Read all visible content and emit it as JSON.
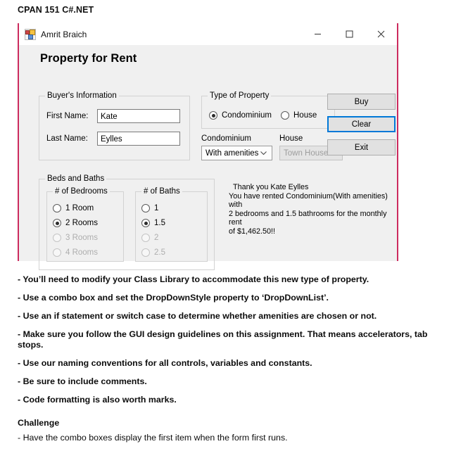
{
  "document": {
    "heading": "CPAN 151 C#.NET"
  },
  "window": {
    "title": "Amrit Braich",
    "icon": "winforms-app-icon",
    "controls": {
      "minimize": "minimize-icon",
      "maximize": "maximize-icon",
      "close": "close-icon"
    },
    "form_title": "Property for Rent"
  },
  "buyer_group": {
    "legend": "Buyer's Information",
    "first_name_label": "First Name:",
    "first_name_value": "Kate",
    "last_name_label": "Last Name:",
    "last_name_value": "Eylles"
  },
  "type_group": {
    "legend": "Type of Property",
    "options": [
      {
        "label": "Condominium",
        "checked": true,
        "enabled": true
      },
      {
        "label": "House",
        "checked": false,
        "enabled": true
      }
    ]
  },
  "combos": {
    "condominium_label": "Condominium",
    "condominium_value": "With amenities",
    "condominium_enabled": true,
    "house_label": "House",
    "house_value": "Town House",
    "house_enabled": false
  },
  "buttons": {
    "buy": "Buy",
    "clear": "Clear",
    "exit": "Exit",
    "focused": "Clear",
    "focus_color": "#0078d7"
  },
  "beds_baths": {
    "legend": "Beds and Baths",
    "bedrooms_legend": "# of Bedrooms",
    "bedrooms": [
      {
        "label": "1 Room",
        "checked": false,
        "enabled": true
      },
      {
        "label": "2 Rooms",
        "checked": true,
        "enabled": true
      },
      {
        "label": "3 Rooms",
        "checked": false,
        "enabled": false
      },
      {
        "label": "4 Rooms",
        "checked": false,
        "enabled": false
      }
    ],
    "baths_legend": "# of Baths",
    "baths": [
      {
        "label": "1",
        "checked": false,
        "enabled": true
      },
      {
        "label": "1.5",
        "checked": true,
        "enabled": true
      },
      {
        "label": "2",
        "checked": false,
        "enabled": false
      },
      {
        "label": "2.5",
        "checked": false,
        "enabled": false
      }
    ]
  },
  "result": {
    "line1": "Thank you Kate Eylles",
    "line2": "You have rented Condominium(With amenities) with",
    "line3": "2 bedrooms and 1.5 bathrooms for the monthly rent",
    "line4": "of $1,462.50!!"
  },
  "instructions": {
    "items": [
      "- You’ll need to modify your Class Library to accommodate this new type of property.",
      "- Use a combo box and set the DropDownStyle property to ‘DropDownList’.",
      "- Use an if statement or switch case to determine whether amenities are chosen or not.",
      "- Make sure you follow the GUI design guidelines on this assignment. That means accelerators, tab stops.",
      "- Use our naming conventions for all controls, variables and constants.",
      "- Be sure to include comments.",
      "- Code formatting is also worth marks."
    ]
  },
  "challenge": {
    "heading": "Challenge",
    "line": "- Have the combo boxes display the first item when the form first runs."
  },
  "theme": {
    "window_border": "#cc2b5e",
    "client_bg": "#f0f0f0",
    "accent": "#0078d7"
  }
}
